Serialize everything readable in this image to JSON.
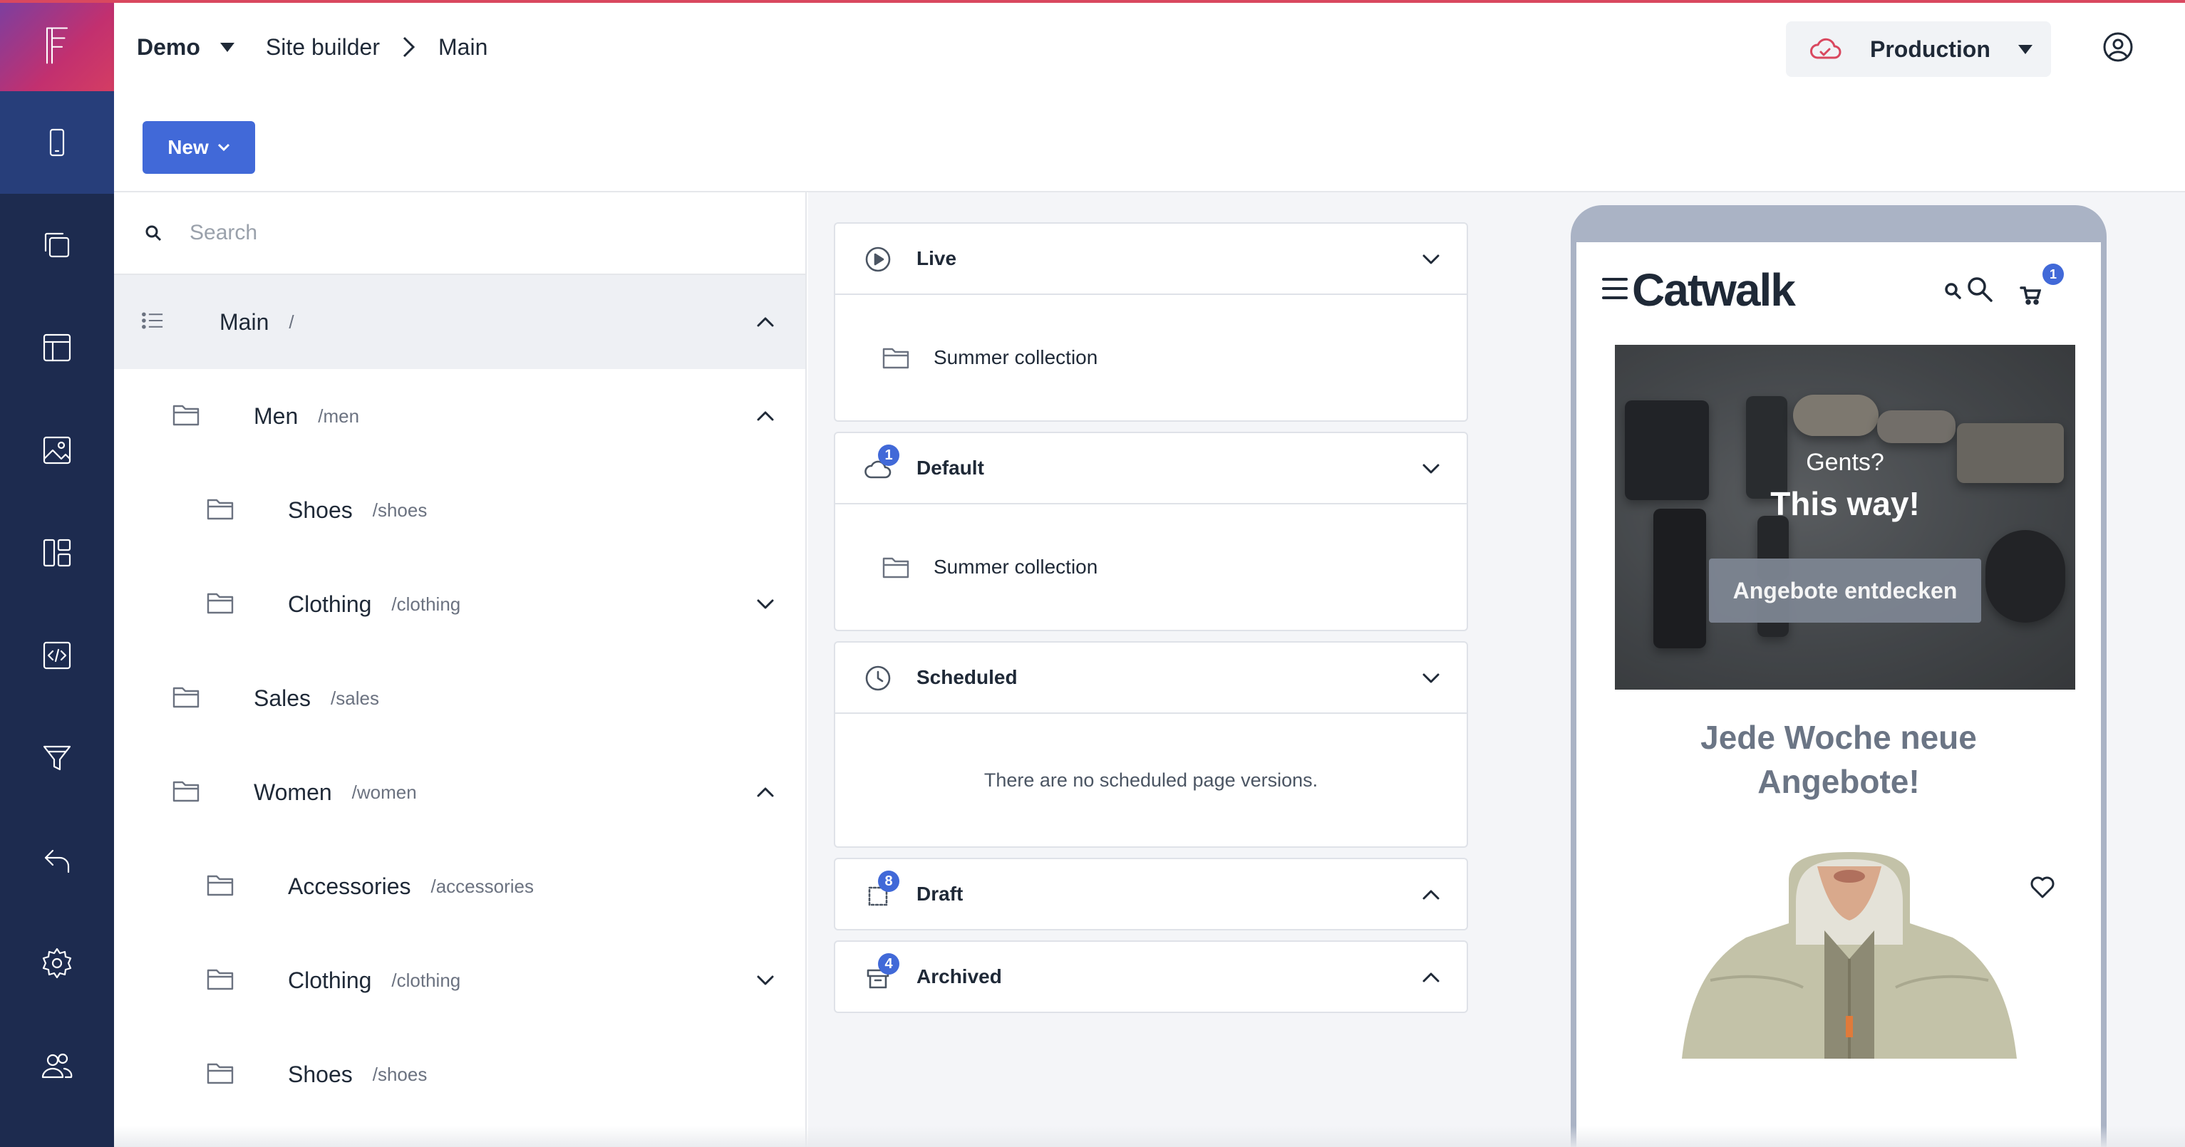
{
  "header": {
    "project": "Demo",
    "breadcrumb": [
      "Site builder",
      "Main"
    ],
    "environment": "Production",
    "icons": {
      "environment": "cloud-icon",
      "user": "user-circle-icon"
    }
  },
  "colors": {
    "rail": "#1d2b4f",
    "rail_active": "#273e7a",
    "accent": "#4169d8",
    "environment_icon": "#d9485f"
  },
  "rail": {
    "items": [
      {
        "icon": "mobile-device-icon",
        "active": true
      },
      {
        "icon": "copy-layers-icon"
      },
      {
        "icon": "layout-icon"
      },
      {
        "icon": "image-icon"
      },
      {
        "icon": "dashboard-icon"
      },
      {
        "icon": "code-icon"
      },
      {
        "icon": "filter-icon"
      },
      {
        "icon": "undo-icon"
      },
      {
        "icon": "settings-icon"
      },
      {
        "icon": "users-icon"
      }
    ]
  },
  "toolbar": {
    "new_label": "New"
  },
  "tree": {
    "search_placeholder": "Search",
    "rows": [
      {
        "name": "Main",
        "path": "/",
        "icon": "list-icon",
        "caret": "up",
        "selected": true
      },
      {
        "name": "Men",
        "path": "/men",
        "icon": "folder-icon",
        "caret": "up"
      },
      {
        "name": "Shoes",
        "path": "/shoes",
        "icon": "folder-icon"
      },
      {
        "name": "Clothing",
        "path": "/clothing",
        "icon": "folder-icon",
        "caret": "down"
      },
      {
        "name": "Sales",
        "path": "/sales",
        "icon": "folder-icon"
      },
      {
        "name": "Women",
        "path": "/women",
        "icon": "folder-icon",
        "caret": "up"
      },
      {
        "name": "Accessories",
        "path": "/accessories",
        "icon": "folder-icon"
      },
      {
        "name": "Clothing",
        "path": "/clothing",
        "icon": "folder-icon",
        "caret": "down"
      },
      {
        "name": "Shoes",
        "path": "/shoes",
        "icon": "folder-icon"
      }
    ]
  },
  "versions": {
    "live": {
      "title": "Live",
      "item": "Summer collection",
      "icon": "play-circle-icon"
    },
    "default": {
      "title": "Default",
      "item": "Summer collection",
      "badge": "1",
      "icon": "cloud-icon"
    },
    "scheduled": {
      "title": "Scheduled",
      "empty": "There are no scheduled page versions.",
      "icon": "clock-icon"
    },
    "draft": {
      "title": "Draft",
      "badge": "8",
      "icon": "draft-icon"
    },
    "archived": {
      "title": "Archived",
      "badge": "4",
      "icon": "archive-icon"
    }
  },
  "preview": {
    "brand": "Catwalk",
    "cart_count": "1",
    "hero_kicker": "Gents?",
    "hero_headline": "This way!",
    "hero_cta": "Angebote entdecken",
    "promo_line1": "Jede Woche neue",
    "promo_line2": "Angebote!"
  }
}
